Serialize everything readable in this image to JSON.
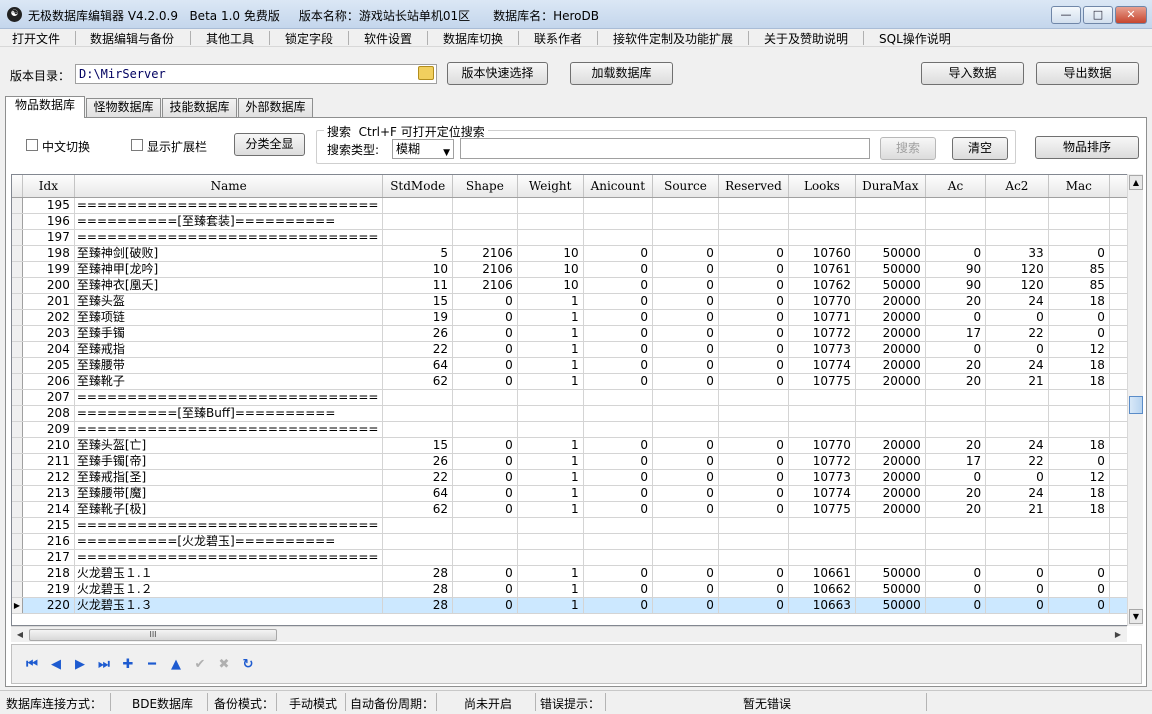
{
  "window": {
    "title": "无极数据库编辑器 V4.2.0.9   Beta 1.0 免费版     版本名称：游戏站长站单机01区      数据库名：HeroDB",
    "minimize": "—",
    "maximize": "□",
    "close": "✕"
  },
  "menu": [
    "打开文件",
    "数据编辑与备份",
    "其他工具",
    "锁定字段",
    "软件设置",
    "数据库切换",
    "联系作者",
    "接软件定制及功能扩展",
    "关于及赞助说明",
    "SQL操作说明"
  ],
  "toolbar": {
    "dir_label": "版本目录：",
    "dir_value": "D:\\MirServer",
    "quick_select": "版本快速选择",
    "load_db": "加载数据库",
    "import": "导入数据",
    "export": "导出数据"
  },
  "tabs": [
    "物品数据库",
    "怪物数据库",
    "技能数据库",
    "外部数据库"
  ],
  "filter": {
    "cn_switch": "中文切换",
    "show_ext": "显示扩展栏",
    "show_all": "分类全显",
    "search_title": "搜索  Ctrl+F 可打开定位搜索",
    "search_type_label": "搜索类型:",
    "search_type_value": "模糊",
    "search_btn": "搜索",
    "clear_btn": "清空",
    "sort_btn": "物品排序"
  },
  "grid": {
    "columns": [
      "Idx",
      "Name",
      "StdMode",
      "Shape",
      "Weight",
      "Anicount",
      "Source",
      "Reserved",
      "Looks",
      "DuraMax",
      "Ac",
      "Ac2",
      "Mac"
    ],
    "rows": [
      [
        "195",
        "==============================",
        "",
        "",
        "",
        "",
        "",
        "",
        "",
        "",
        "",
        "",
        ""
      ],
      [
        "196",
        "==========[至臻套装]==========",
        "",
        "",
        "",
        "",
        "",
        "",
        "",
        "",
        "",
        "",
        ""
      ],
      [
        "197",
        "==============================",
        "",
        "",
        "",
        "",
        "",
        "",
        "",
        "",
        "",
        "",
        ""
      ],
      [
        "198",
        "至臻神剑[破败]",
        "5",
        "2106",
        "10",
        "0",
        "0",
        "0",
        "10760",
        "50000",
        "0",
        "33",
        "0"
      ],
      [
        "199",
        "至臻神甲[龙吟]",
        "10",
        "2106",
        "10",
        "0",
        "0",
        "0",
        "10761",
        "50000",
        "90",
        "120",
        "85"
      ],
      [
        "200",
        "至臻神衣[凰夭]",
        "11",
        "2106",
        "10",
        "0",
        "0",
        "0",
        "10762",
        "50000",
        "90",
        "120",
        "85"
      ],
      [
        "201",
        "至臻头盔",
        "15",
        "0",
        "1",
        "0",
        "0",
        "0",
        "10770",
        "20000",
        "20",
        "24",
        "18"
      ],
      [
        "202",
        "至臻项链",
        "19",
        "0",
        "1",
        "0",
        "0",
        "0",
        "10771",
        "20000",
        "0",
        "0",
        "0"
      ],
      [
        "203",
        "至臻手镯",
        "26",
        "0",
        "1",
        "0",
        "0",
        "0",
        "10772",
        "20000",
        "17",
        "22",
        "0"
      ],
      [
        "204",
        "至臻戒指",
        "22",
        "0",
        "1",
        "0",
        "0",
        "0",
        "10773",
        "20000",
        "0",
        "0",
        "12"
      ],
      [
        "205",
        "至臻腰带",
        "64",
        "0",
        "1",
        "0",
        "0",
        "0",
        "10774",
        "20000",
        "20",
        "24",
        "18"
      ],
      [
        "206",
        "至臻靴子",
        "62",
        "0",
        "1",
        "0",
        "0",
        "0",
        "10775",
        "20000",
        "20",
        "21",
        "18"
      ],
      [
        "207",
        "==============================",
        "",
        "",
        "",
        "",
        "",
        "",
        "",
        "",
        "",
        "",
        ""
      ],
      [
        "208",
        "==========[至臻Buff]==========",
        "",
        "",
        "",
        "",
        "",
        "",
        "",
        "",
        "",
        "",
        ""
      ],
      [
        "209",
        "==============================",
        "",
        "",
        "",
        "",
        "",
        "",
        "",
        "",
        "",
        "",
        ""
      ],
      [
        "210",
        "至臻头盔[亡]",
        "15",
        "0",
        "1",
        "0",
        "0",
        "0",
        "10770",
        "20000",
        "20",
        "24",
        "18"
      ],
      [
        "211",
        "至臻手镯[帝]",
        "26",
        "0",
        "1",
        "0",
        "0",
        "0",
        "10772",
        "20000",
        "17",
        "22",
        "0"
      ],
      [
        "212",
        "至臻戒指[圣]",
        "22",
        "0",
        "1",
        "0",
        "0",
        "0",
        "10773",
        "20000",
        "0",
        "0",
        "12"
      ],
      [
        "213",
        "至臻腰带[魔]",
        "64",
        "0",
        "1",
        "0",
        "0",
        "0",
        "10774",
        "20000",
        "20",
        "24",
        "18"
      ],
      [
        "214",
        "至臻靴子[极]",
        "62",
        "0",
        "1",
        "0",
        "0",
        "0",
        "10775",
        "20000",
        "20",
        "21",
        "18"
      ],
      [
        "215",
        "==============================",
        "",
        "",
        "",
        "",
        "",
        "",
        "",
        "",
        "",
        "",
        ""
      ],
      [
        "216",
        "==========[火龙碧玉]==========",
        "",
        "",
        "",
        "",
        "",
        "",
        "",
        "",
        "",
        "",
        ""
      ],
      [
        "217",
        "==============================",
        "",
        "",
        "",
        "",
        "",
        "",
        "",
        "",
        "",
        "",
        ""
      ],
      [
        "218",
        "火龙碧玉１.１",
        "28",
        "0",
        "1",
        "0",
        "0",
        "0",
        "10661",
        "50000",
        "0",
        "0",
        "0"
      ],
      [
        "219",
        "火龙碧玉１.２",
        "28",
        "0",
        "1",
        "0",
        "0",
        "0",
        "10662",
        "50000",
        "0",
        "0",
        "0"
      ],
      [
        "220",
        "火龙碧玉１.３",
        "28",
        "0",
        "1",
        "0",
        "0",
        "0",
        "10663",
        "50000",
        "0",
        "0",
        "0"
      ]
    ],
    "selected_index": 25,
    "indicator": "▶",
    "hscroll_thumb": "III"
  },
  "status": {
    "conn_label": "数据库连接方式：",
    "conn_value": "BDE数据库",
    "backup_label": "备份模式：",
    "backup_value": "手动模式",
    "auto_label": "自动备份周期：",
    "auto_value": "尚未开启",
    "err_label": "错误提示：",
    "err_value": "暂无错误"
  },
  "colors": {
    "selection": "#cce8ff",
    "nav_icon": "#1e5bd0",
    "path_text": "#000060"
  }
}
